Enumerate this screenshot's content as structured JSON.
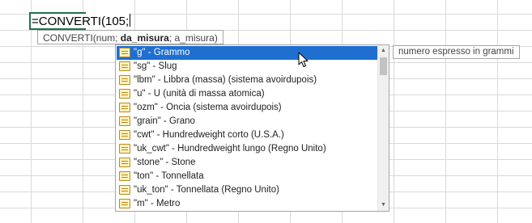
{
  "formula_bar": {
    "value": "=CONVERTI(105;"
  },
  "syntax_tooltip": {
    "prefix": "CONVERTI(num; ",
    "current_arg": "da_misura",
    "suffix": "; a_misura)"
  },
  "autocomplete": {
    "items": [
      "\"g\" - Grammo",
      "\"sg\" - Slug",
      "\"lbm\" - Libbra (massa) (sistema avoirdupois)",
      "\"u\" - U (unità di massa atomica)",
      "\"ozm\" - Oncia (sistema avoirdupois)",
      "\"grain\" - Grano",
      "\"cwt\" - Hundredweight corto (U.S.A.)",
      "\"uk_cwt\" - Hundredweight lungo (Regno Unito)",
      "\"stone\" - Stone",
      "\"ton\" - Tonnellata",
      "\"uk_ton\" - Tonnellata (Regno Unito)",
      "\"m\" - Metro"
    ],
    "selected_index": 0,
    "scroll_up_icon": "scroll-up-arrow-icon",
    "scroll_down_icon": "scroll-down-arrow-icon",
    "item_icon": "function-argument-icon"
  },
  "description_tooltip": {
    "text": "numero espresso in grammi"
  },
  "colors": {
    "selection": "#1e6fd0",
    "active_cell_border": "#217346",
    "gridline": "#d9d9d9"
  }
}
